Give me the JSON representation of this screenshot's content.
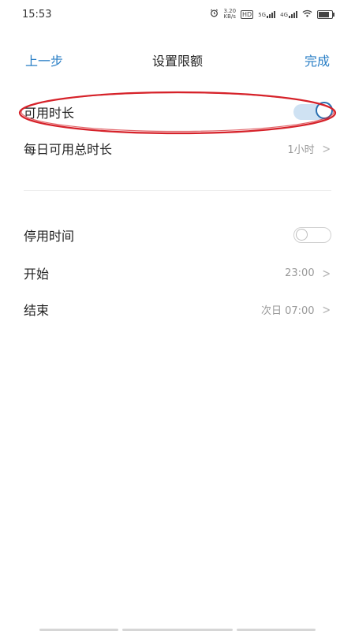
{
  "status_bar": {
    "time": "15:53",
    "net_speed_value": "3.20",
    "net_speed_unit": "KB/s",
    "hd_label": "HD",
    "sim1_label": "5G",
    "sim2_label": "4G"
  },
  "nav": {
    "back_label": "上一步",
    "title": "设置限额",
    "done_label": "完成"
  },
  "section_limit": {
    "available_duration_label": "可用时长",
    "available_duration_on": true,
    "daily_total_label": "每日可用总时长",
    "daily_total_value": "1小时"
  },
  "section_downtime": {
    "downtime_label": "停用时间",
    "downtime_on": false,
    "start_label": "开始",
    "start_value": "23:00",
    "end_label": "结束",
    "end_value": "次日 07:00"
  },
  "colors": {
    "accent": "#2a7fc6",
    "annotation": "#d6222a"
  },
  "icons": {
    "chevron": "chevron-right-icon",
    "alarm": "alarm-icon",
    "wifi": "wifi-icon",
    "battery": "battery-icon"
  }
}
